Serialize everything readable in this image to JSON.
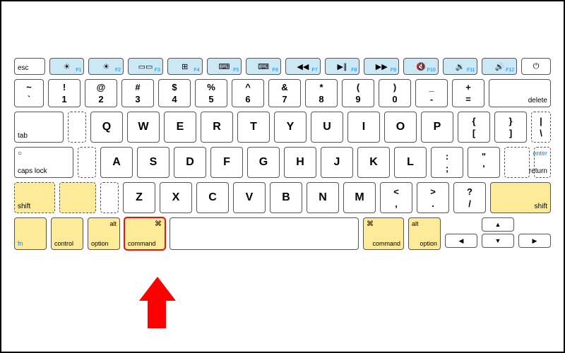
{
  "keys": {
    "esc": "esc",
    "f1_sub": "F1",
    "f2_sub": "F2",
    "f3_sub": "F3",
    "f4_sub": "F4",
    "f5_sub": "F5",
    "f6_sub": "F6",
    "f7_sub": "F7",
    "f8_sub": "F8",
    "f9_sub": "F9",
    "f10_sub": "F10",
    "f11_sub": "F11",
    "f12_sub": "F12",
    "f1_icon": "☀",
    "f2_icon": "☀",
    "f3_icon": "▭▭",
    "f4_icon": "⊞",
    "f5_icon": "⌨",
    "f6_icon": "⌨",
    "f7_icon": "◀◀",
    "f8_icon": "▶∥",
    "f9_icon": "▶▶",
    "f10_icon": "🔇",
    "f11_icon": "🔉",
    "f12_icon": "🔊",
    "power_icon": "⏻",
    "tilde_u": "~",
    "tilde_l": "`",
    "n1_u": "!",
    "n1_l": "1",
    "n2_u": "@",
    "n2_l": "2",
    "n3_u": "#",
    "n3_l": "3",
    "n4_u": "$",
    "n4_l": "4",
    "n5_u": "%",
    "n5_l": "5",
    "n6_u": "^",
    "n6_l": "6",
    "n7_u": "&",
    "n7_l": "7",
    "n8_u": "*",
    "n8_l": "8",
    "n9_u": "(",
    "n9_l": "9",
    "n0_u": ")",
    "n0_l": "0",
    "minus_u": "_",
    "minus_l": "-",
    "eq_u": "+",
    "eq_l": "=",
    "delete": "delete",
    "tab": "tab",
    "Q": "Q",
    "W": "W",
    "E": "E",
    "R": "R",
    "T": "T",
    "Y": "Y",
    "U": "U",
    "I": "I",
    "O": "O",
    "P": "P",
    "lb_u": "{",
    "lb_l": "[",
    "rb_u": "}",
    "rb_l": "]",
    "bs_u": "|",
    "bs_l": "\\",
    "caps": "caps lock",
    "A": "A",
    "S": "S",
    "D": "D",
    "F": "F",
    "G": "G",
    "H": "H",
    "J": "J",
    "K": "K",
    "L": "L",
    "semi_u": ":",
    "semi_l": ";",
    "quote_u": "\"",
    "quote_l": "'",
    "enter": "enter",
    "return": "return",
    "shift": "shift",
    "Z": "Z",
    "X": "X",
    "C": "C",
    "V": "V",
    "B": "B",
    "N": "N",
    "M": "M",
    "comma_u": "<",
    "comma_l": ",",
    "dot_u": ">",
    "dot_l": ".",
    "slash_u": "?",
    "slash_l": "/",
    "fn": "fn",
    "control": "control",
    "alt": "alt",
    "option": "option",
    "cmd_sym": "⌘",
    "command": "command",
    "up": "▲",
    "left": "◀",
    "down": "▼",
    "right": "▶"
  }
}
